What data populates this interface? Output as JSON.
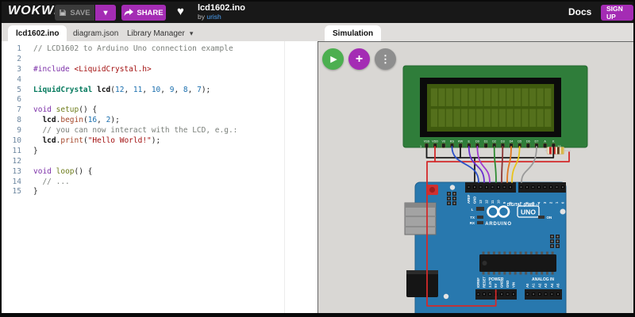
{
  "topbar": {
    "logo": "WOKWi",
    "save_label": "SAVE",
    "share_label": "SHARE",
    "title": "lcd1602.ino",
    "by_prefix": "by",
    "author": "urish",
    "docs_label": "Docs",
    "signup_label": "SIGN UP"
  },
  "icons": {
    "caret_down": "▾",
    "kebab": "⋮",
    "play": "▶",
    "plus": "+",
    "heart": "♥"
  },
  "file_tabs": [
    {
      "label": "lcd1602.ino",
      "active": true
    },
    {
      "label": "diagram.json",
      "active": false
    },
    {
      "label": "Library Manager",
      "active": false
    }
  ],
  "editor": {
    "lines": [
      [
        [
          "com",
          "// LCD1602 to Arduino Uno connection example"
        ]
      ],
      [],
      [
        [
          "kw",
          "#include"
        ],
        [
          "pl",
          " "
        ],
        [
          "str",
          "<LiquidCrystal.h>"
        ]
      ],
      [],
      [
        [
          "type",
          "LiquidCrystal"
        ],
        [
          "pl",
          " "
        ],
        [
          "var",
          "lcd"
        ],
        [
          "pl",
          "("
        ],
        [
          "num",
          "12"
        ],
        [
          "pl",
          ", "
        ],
        [
          "num",
          "11"
        ],
        [
          "pl",
          ", "
        ],
        [
          "num",
          "10"
        ],
        [
          "pl",
          ", "
        ],
        [
          "num",
          "9"
        ],
        [
          "pl",
          ", "
        ],
        [
          "num",
          "8"
        ],
        [
          "pl",
          ", "
        ],
        [
          "num",
          "7"
        ],
        [
          "pl",
          ");"
        ]
      ],
      [],
      [
        [
          "kw",
          "void"
        ],
        [
          "pl",
          " "
        ],
        [
          "fn",
          "setup"
        ],
        [
          "pl",
          "() {"
        ]
      ],
      [
        [
          "pl",
          "  "
        ],
        [
          "var",
          "lcd"
        ],
        [
          "pl",
          "."
        ],
        [
          "meth",
          "begin"
        ],
        [
          "pl",
          "("
        ],
        [
          "num",
          "16"
        ],
        [
          "pl",
          ", "
        ],
        [
          "num",
          "2"
        ],
        [
          "pl",
          ");"
        ]
      ],
      [
        [
          "pl",
          "  "
        ],
        [
          "com",
          "// you can now interact with the LCD, e.g.:"
        ]
      ],
      [
        [
          "pl",
          "  "
        ],
        [
          "var",
          "lcd"
        ],
        [
          "pl",
          "."
        ],
        [
          "meth",
          "print"
        ],
        [
          "pl",
          "("
        ],
        [
          "str",
          "\"Hello World!\""
        ],
        [
          "pl",
          ");"
        ]
      ],
      [
        [
          "pl",
          "}"
        ]
      ],
      [],
      [
        [
          "kw",
          "void"
        ],
        [
          "pl",
          " "
        ],
        [
          "fn",
          "loop"
        ],
        [
          "pl",
          "() {"
        ]
      ],
      [
        [
          "pl",
          "  "
        ],
        [
          "com",
          "// ..."
        ]
      ],
      [
        [
          "pl",
          "}"
        ]
      ]
    ]
  },
  "simulation": {
    "tab_label": "Simulation",
    "lcd": {
      "pin_labels": [
        "VSS",
        "VDD",
        "V0",
        "RS",
        "RW",
        "E",
        "D0",
        "D1",
        "D2",
        "D3",
        "D4",
        "D5",
        "D6",
        "D7",
        "A",
        "K"
      ],
      "pin_first": "1",
      "pin_last": "16"
    },
    "arduino": {
      "digital_left": [
        "AREF",
        "GND",
        "13",
        "12",
        "11",
        "10",
        "9",
        "8"
      ],
      "digital_right": [
        "7",
        "6",
        "5",
        "4",
        "3",
        "2",
        "1",
        "0"
      ],
      "digital_caption": "DIGITAL (PWM ~)",
      "power_caption": "POWER",
      "power_pins": [
        "IOREF",
        "RESET",
        "3.3V",
        "5V",
        "GND",
        "GND",
        "VIN"
      ],
      "analog_caption": "ANALOG IN",
      "analog_pins": [
        "A0",
        "A1",
        "A2",
        "A3",
        "A4",
        "A5"
      ],
      "brand": "ARDUINO",
      "model": "UNO",
      "led_l": "L",
      "led_tx": "TX",
      "led_rx": "RX",
      "led_on": "ON"
    }
  },
  "colors": {
    "accent_purple": "#a42cb4",
    "play_green": "#4caf50",
    "board_blue": "#2878ae",
    "lcd_green": "#2f7d3a",
    "link_blue": "#4ba0f4"
  }
}
